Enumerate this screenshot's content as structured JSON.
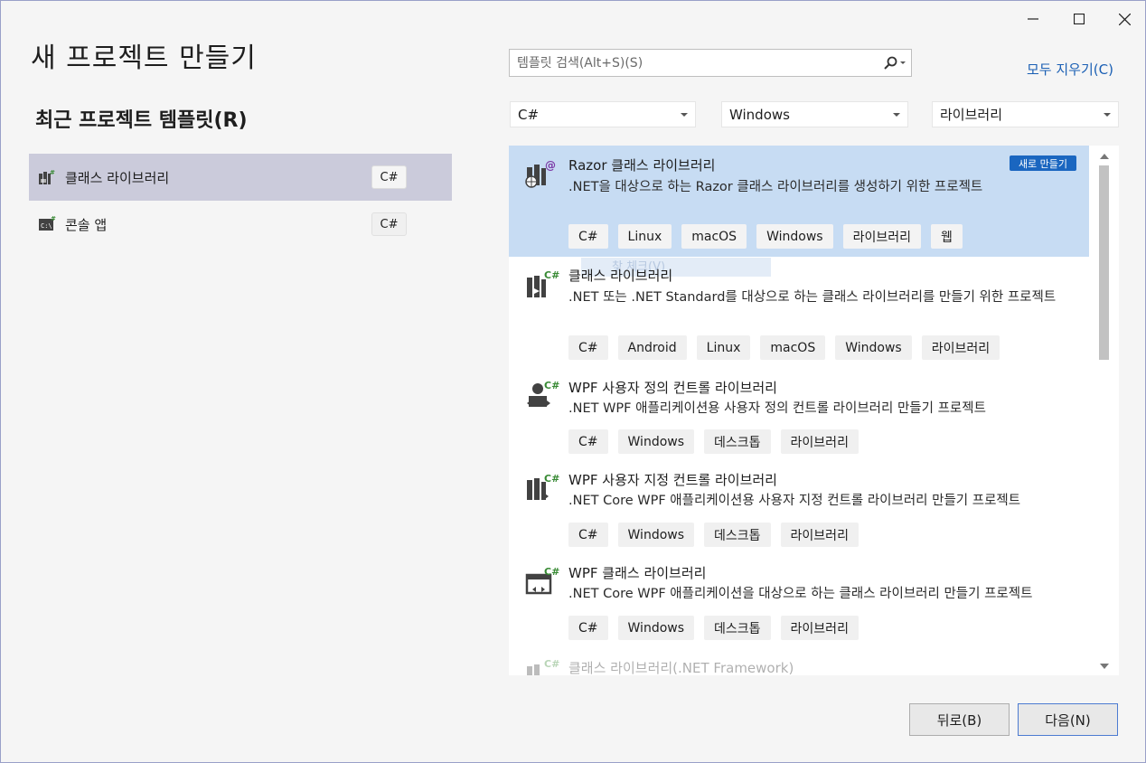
{
  "window": {
    "title": "새 프로젝트 만들기"
  },
  "recent": {
    "heading": "최근 프로젝트 템플릿(R)",
    "items": [
      {
        "label": "클래스 라이브러리",
        "lang": "C#",
        "icon": "class-library-icon",
        "selected": true
      },
      {
        "label": "콘솔 앱",
        "lang": "C#",
        "icon": "console-app-icon",
        "selected": false
      }
    ]
  },
  "search": {
    "placeholder": "템플릿 검색(Alt+S)(S)",
    "clear_all": "모두 지우기(C)"
  },
  "filters": {
    "language": "C#",
    "platform": "Windows",
    "project_type": "라이브러리"
  },
  "templates": [
    {
      "title": "Razor 클래스 라이브러리",
      "desc": ".NET을 대상으로 하는 Razor 클래스 라이브러리를 생성하기 위한 프로젝트",
      "tags": [
        "C#",
        "Linux",
        "macOS",
        "Windows",
        "라이브러리",
        "웹"
      ],
      "badge": "새로 만들기",
      "icon": "razor-class-library-icon"
    },
    {
      "title": "클래스 라이브러리",
      "desc": ".NET 또는 .NET Standard를 대상으로 하는 클래스 라이브러리를 만들기 위한 프로젝트",
      "tags": [
        "C#",
        "Android",
        "Linux",
        "macOS",
        "Windows",
        "라이브러리"
      ],
      "icon": "class-library-icon"
    },
    {
      "title": "WPF 사용자 정의 컨트롤 라이브러리",
      "desc": ".NET WPF 애플리케이션용 사용자 정의 컨트롤 라이브러리 만들기 프로젝트",
      "tags": [
        "C#",
        "Windows",
        "데스크톱",
        "라이브러리"
      ],
      "icon": "wpf-custom-control-icon"
    },
    {
      "title": "WPF 사용자 지정 컨트롤 라이브러리",
      "desc": ".NET Core WPF 애플리케이션용 사용자 지정 컨트롤 라이브러리 만들기 프로젝트",
      "tags": [
        "C#",
        "Windows",
        "데스크톱",
        "라이브러리"
      ],
      "icon": "wpf-user-control-icon"
    },
    {
      "title": "WPF 클래스 라이브러리",
      "desc": ".NET Core WPF 애플리케이션을 대상으로 하는 클래스 라이브러리 만들기 프로젝트",
      "tags": [
        "C#",
        "Windows",
        "데스크톱",
        "라이브러리"
      ],
      "icon": "wpf-class-library-icon"
    },
    {
      "title": "클래스 라이브러리(.NET Framework)",
      "icon": "class-library-framework-icon"
    }
  ],
  "ghost_tip": "찾 체크(V)",
  "footer": {
    "back": "뒤로(B)",
    "next": "다음(N)"
  },
  "colors": {
    "selected_template": "#c7dcf3",
    "selected_recent": "#cbcbdb",
    "badge": "#1a66c0",
    "link": "#1a5fb4",
    "csharp_green": "#388a34"
  }
}
